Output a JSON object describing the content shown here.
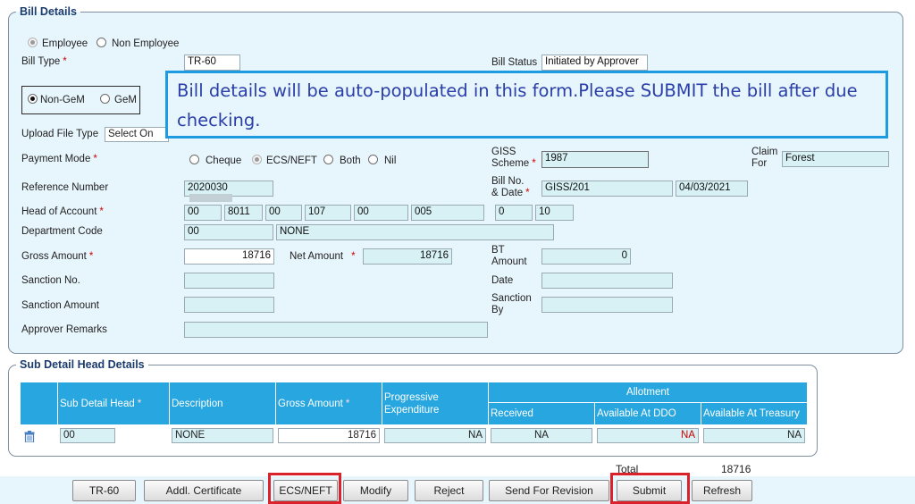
{
  "bill_details": {
    "legend": "Bill Details",
    "employee_radio": "Employee",
    "non_employee_radio": "Non Employee",
    "bill_type_label": "Bill Type",
    "bill_type_value": "TR-60",
    "bill_status_label": "Bill Status",
    "bill_status_value": "Initiated by Approver",
    "non_gem_radio": "Non-GeM",
    "gem_radio": "GeM",
    "upload_file_type_label": "Upload File Type",
    "upload_file_type_value": "Select On",
    "payment_mode_label": "Payment Mode",
    "payment_options": {
      "cheque": "Cheque",
      "ecs": "ECS/NEFT",
      "both": "Both",
      "nil": "Nil"
    },
    "giss_scheme_label_1": "GISS",
    "giss_scheme_label_2": "Scheme",
    "giss_scheme_value": "1987",
    "claim_for_label_1": "Claim",
    "claim_for_label_2": "For",
    "claim_for_value": "Forest",
    "reference_number_label": "Reference Number",
    "reference_number_value": "2020030",
    "bill_no_label_1": "Bill No.",
    "bill_no_label_2": "& Date",
    "bill_no_value": "GISS/201",
    "bill_date_value": "04/03/2021",
    "head_of_account_label": "Head of Account",
    "head_of_account": [
      "00",
      "8011",
      "00",
      "107",
      "00",
      "005",
      "0",
      "10"
    ],
    "department_code_label": "Department Code",
    "department_code_value": "00",
    "department_name_value": "NONE",
    "gross_amount_label": "Gross Amount",
    "gross_amount_value": "18716",
    "net_amount_label": "Net Amount",
    "net_amount_value": "18716",
    "bt_amount_label_1": "BT",
    "bt_amount_label_2": "Amount",
    "bt_amount_value": "0",
    "sanction_no_label": "Sanction No.",
    "date_label": "Date",
    "sanction_amount_label": "Sanction Amount",
    "sanction_by_label_1": "Sanction",
    "sanction_by_label_2": "By",
    "approver_remarks_label": "Approver Remarks"
  },
  "callout": {
    "text": "Bill details will be auto-populated in this form.Please SUBMIT the bill after due checking."
  },
  "sub_detail": {
    "legend": "Sub Detail Head Details",
    "headers": {
      "sub_detail_head": "Sub Detail Head",
      "description": "Description",
      "gross_amount": "Gross Amount",
      "progressive_1": "Progressive",
      "progressive_2": "Expenditure",
      "allotment": "Allotment",
      "received": "Received",
      "available_ddo": "Available At DDO",
      "available_treasury": "Available At Treasury"
    },
    "row": {
      "sub_detail_head": "00",
      "description": "NONE",
      "gross_amount": "18716",
      "progressive": "NA",
      "received": "NA",
      "available_ddo": "NA",
      "available_treasury": "NA"
    },
    "total_label": "Total",
    "total_value": "18716"
  },
  "buttons": {
    "tr60": "TR-60",
    "addl_certificate": "Addl. Certificate",
    "ecs_neft": "ECS/NEFT",
    "modify": "Modify",
    "reject": "Reject",
    "send_for_revision": "Send For Revision",
    "submit": "Submit",
    "refresh": "Refresh"
  },
  "colors": {
    "panel_bg": "#e7f5fd",
    "field_bg": "#d7f1f5",
    "table_header": "#27a6df",
    "callout_border": "#1e9be0",
    "callout_text": "#2a3ea8",
    "highlight_red": "#d9222a",
    "required_red": "#d00000"
  }
}
